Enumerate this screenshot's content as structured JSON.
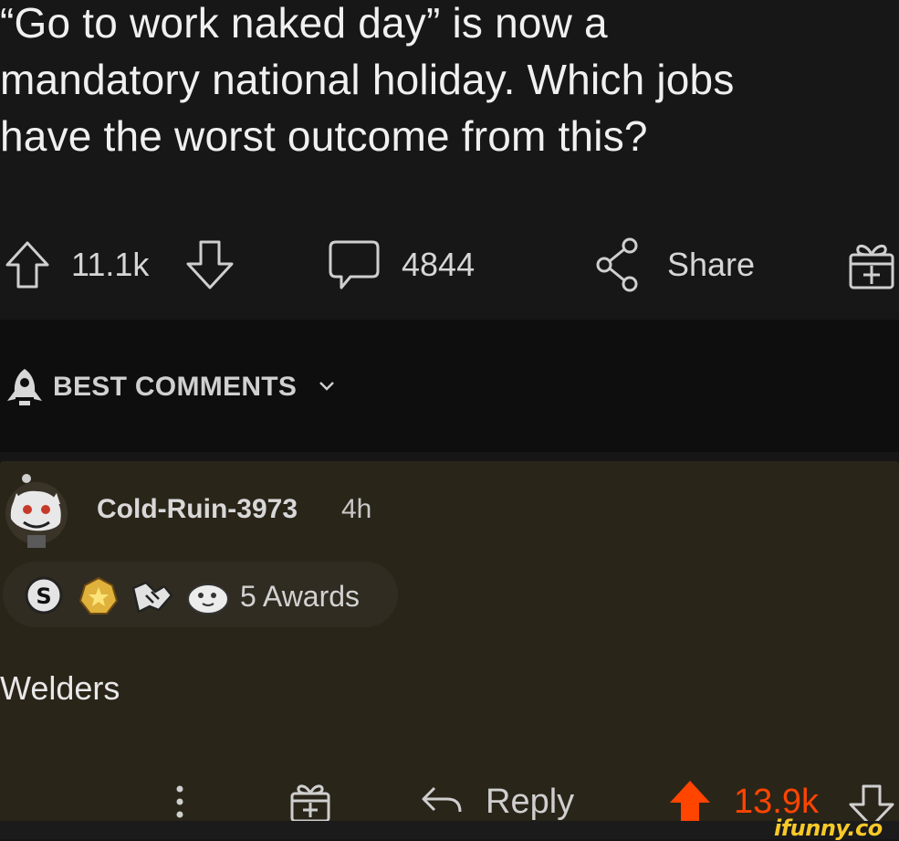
{
  "post": {
    "title": "“Go to work naked day” is now a\nmandatory national holiday. Which jobs\nhave the worst outcome from this?",
    "upvotes": "11.1k",
    "comments": "4844",
    "share_label": "Share"
  },
  "comments_header": {
    "label": "BEST COMMENTS"
  },
  "comment": {
    "username": "Cold-Ruin-3973",
    "time": "4h",
    "awards_label": "5 Awards",
    "body": "Welders",
    "reply_label": "Reply",
    "votes": "13.9k"
  },
  "watermark": {
    "text": "ifunny.co"
  },
  "colors": {
    "upvote_active": "#ff4500",
    "card_bg": "#2a2519",
    "watermark": "#f7c928"
  },
  "icons": [
    "upvote-arrow-icon",
    "downvote-arrow-icon",
    "comment-bubble-icon",
    "share-icon",
    "gift-icon",
    "rocket-icon",
    "chevron-down-icon",
    "more-dots-icon",
    "reply-arrow-icon"
  ]
}
